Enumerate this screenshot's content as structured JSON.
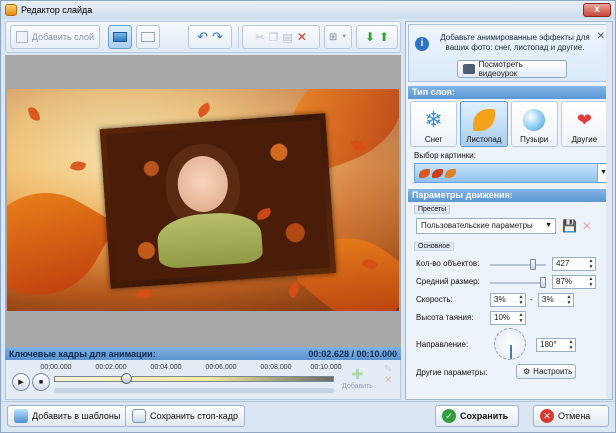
{
  "window": {
    "title": "Редактор слайда",
    "close_label": "x"
  },
  "toolbar": {
    "add_layer": "Добавить слой"
  },
  "timeline": {
    "header": "Ключевые кадры для анимации:",
    "time": "00:02.628 / 00:10.000",
    "ticks": [
      "00:00.000",
      "00:02.000",
      "00:04.000",
      "00:06.000",
      "00:08.000",
      "00:10.000"
    ],
    "add_label": "Добавить"
  },
  "bottom": {
    "add_template": "Добавить в шаблоны",
    "save_frame": "Сохранить стоп-кадр",
    "save": "Сохранить",
    "cancel": "Отмена"
  },
  "panel": {
    "info_text": "Добавьте анимированные эффекты для ваших фото: снег, листопад и другие.",
    "watch_video": "Посмотреть видеоурок",
    "layer_type_header": "Тип слоя:",
    "types": [
      "Снег",
      "Листопад",
      "Пузыри",
      "Другие"
    ],
    "picture_label": "Выбор картинки:",
    "motion_header": "Параметры движения:",
    "presets_label": "Пресеты",
    "preset_value": "Пользовательские параметры",
    "basic_label": "Основное",
    "count_label": "Кол-во объектов:",
    "count_value": "427",
    "size_label": "Средний размер:",
    "size_value": "87%",
    "speed_label": "Скорость:",
    "speed_min": "3%",
    "speed_dash": "-",
    "speed_max": "3%",
    "melt_label": "Высота таяния:",
    "melt_value": "10%",
    "direction_label": "Направление:",
    "direction_value": "180°",
    "other_label": "Другие параметры:",
    "configure": "Настроить"
  }
}
